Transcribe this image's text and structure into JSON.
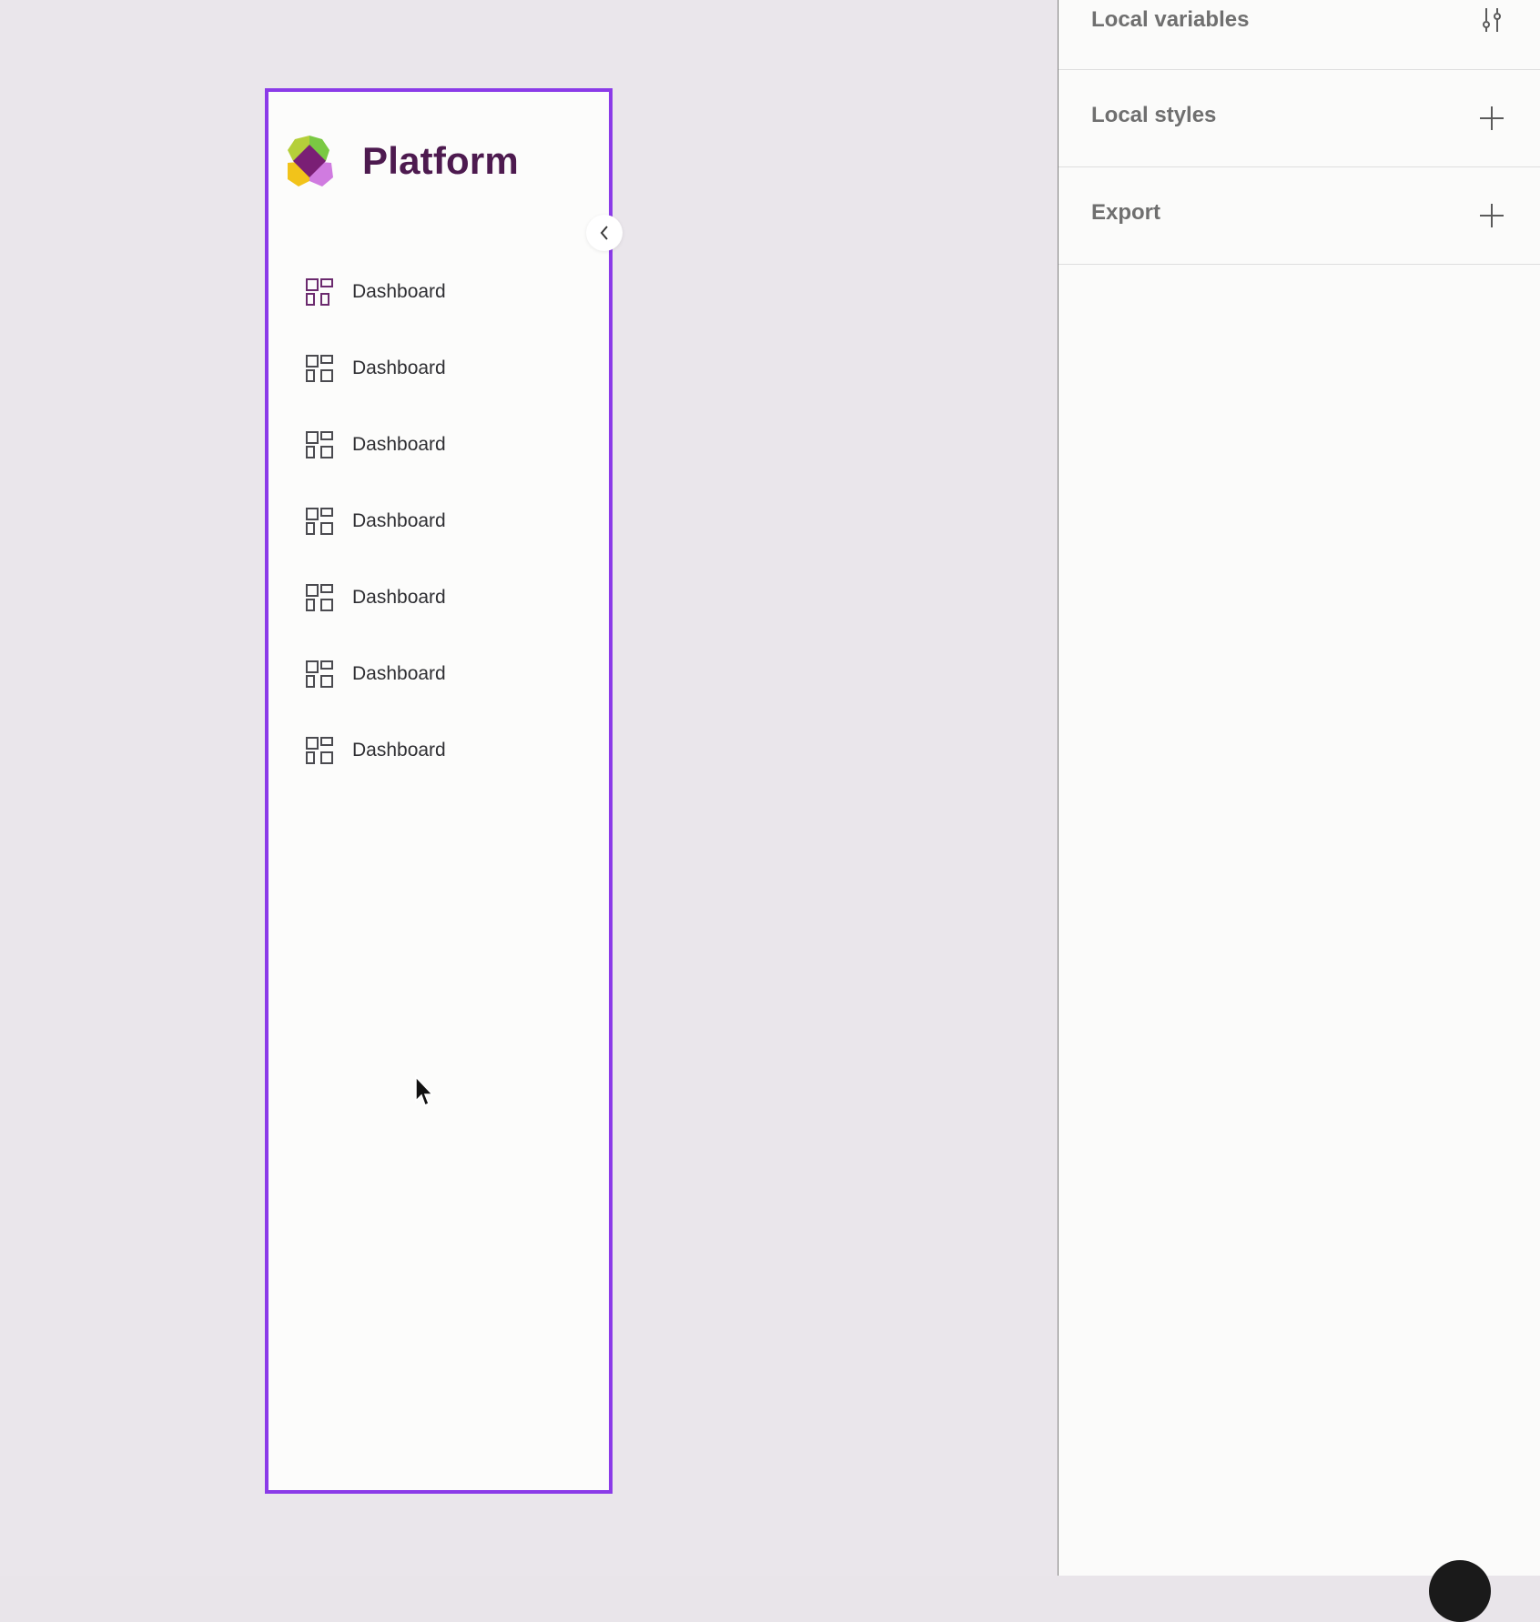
{
  "colors": {
    "canvas_bg": "#eae6eb",
    "frame_border": "#8b3be8",
    "brand_text": "#4d1a4f",
    "panel_bg": "#fbfbfa"
  },
  "sidebar": {
    "brand": "Platform",
    "collapse_icon": "chevron-left-icon",
    "items": [
      {
        "label": "Dashboard",
        "icon": "dashboard-grid-icon",
        "active": true
      },
      {
        "label": "Dashboard",
        "icon": "dashboard-grid-icon",
        "active": false
      },
      {
        "label": "Dashboard",
        "icon": "dashboard-grid-icon",
        "active": false
      },
      {
        "label": "Dashboard",
        "icon": "dashboard-grid-icon",
        "active": false
      },
      {
        "label": "Dashboard",
        "icon": "dashboard-grid-icon",
        "active": false
      },
      {
        "label": "Dashboard",
        "icon": "dashboard-grid-icon",
        "active": false
      },
      {
        "label": "Dashboard",
        "icon": "dashboard-grid-icon",
        "active": false
      }
    ]
  },
  "panel": {
    "sections": [
      {
        "title": "Local variables",
        "action_icon": "sliders-icon"
      },
      {
        "title": "Local styles",
        "action_icon": "plus-icon"
      },
      {
        "title": "Export",
        "action_icon": "plus-icon"
      }
    ]
  }
}
